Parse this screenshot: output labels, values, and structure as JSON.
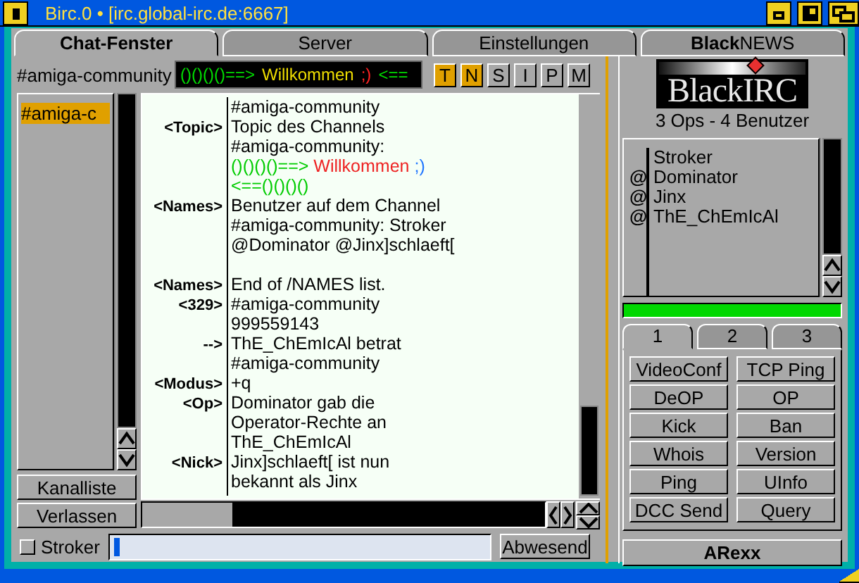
{
  "window": {
    "title": "Birc.0 • [irc.global-irc.de:6667]"
  },
  "tabs": [
    {
      "label": "Chat-Fenster",
      "selected": true
    },
    {
      "label": "Server",
      "selected": false
    },
    {
      "label": "Einstellungen",
      "selected": false
    },
    {
      "label": "**Black**NEWS",
      "selected": false
    }
  ],
  "channel": {
    "name": "#amiga-community",
    "topic": [
      {
        "text": "()()()()==>",
        "color": "#00dd00"
      },
      {
        "text": "Willkommen",
        "color": "#eedd00"
      },
      {
        "text": ";)",
        "color": "#ff2222"
      },
      {
        "text": "<==",
        "color": "#00dd00"
      }
    ]
  },
  "mode_buttons": [
    {
      "label": "T",
      "on": true
    },
    {
      "label": "N",
      "on": true
    },
    {
      "label": "S",
      "on": false
    },
    {
      "label": "I",
      "on": false
    },
    {
      "label": "P",
      "on": false
    },
    {
      "label": "M",
      "on": false
    }
  ],
  "channels": [
    {
      "name": "#amiga-c",
      "selected": true
    }
  ],
  "channel_buttons": [
    "Kanalliste",
    "Verlassen"
  ],
  "chat": [
    {
      "kind": "text",
      "text": "#amiga-community"
    },
    {
      "kind": "text",
      "prefix": "<Topic>",
      "text": "Topic des Channels"
    },
    {
      "kind": "text",
      "text": "#amiga-community:"
    },
    {
      "kind": "text",
      "segments": [
        {
          "text": "()()()()==>",
          "color": "#00cc00"
        },
        {
          "text": "  Willkommen",
          "color": "#ee2222"
        },
        {
          "text": " ;)",
          "color": "#2277ff"
        }
      ]
    },
    {
      "kind": "text",
      "segments": [
        {
          "text": "<==()()()()",
          "color": "#00cc00"
        }
      ]
    },
    {
      "kind": "text",
      "prefix": "<Names>",
      "text": "Benutzer auf dem Channel"
    },
    {
      "kind": "text",
      "text": "#amiga-community: Stroker"
    },
    {
      "kind": "text",
      "text": "@Dominator @Jinx]schlaeft["
    },
    {
      "kind": "blank"
    },
    {
      "kind": "text",
      "prefix": "<Names>",
      "text": "End of /NAMES list."
    },
    {
      "kind": "text",
      "prefix": "<329>",
      "text": "#amiga-community"
    },
    {
      "kind": "text",
      "text": "999559143"
    },
    {
      "kind": "text",
      "prefix": "-->",
      "text": "ThE_ChEmIcAl betrat"
    },
    {
      "kind": "text",
      "text": "#amiga-community"
    },
    {
      "kind": "text",
      "prefix": "<Modus>",
      "text": "+q"
    },
    {
      "kind": "text",
      "prefix": "<Op>",
      "text": "Dominator gab die"
    },
    {
      "kind": "text",
      "text": "Operator-Rechte an"
    },
    {
      "kind": "text",
      "text": "ThE_ChEmIcAl"
    },
    {
      "kind": "text",
      "prefix": "<Nick>",
      "text": "Jinx]schlaeft[ ist nun"
    },
    {
      "kind": "text",
      "text": "bekannt als Jinx"
    }
  ],
  "input": {
    "nick": "Stroker",
    "nick_checked": false,
    "away_button": "Abwesend"
  },
  "logo": "BlackIRC",
  "user_summary": "3 Ops - 4 Benutzer",
  "users": [
    {
      "name": "Stroker"
    },
    {
      "mode": "@",
      "name": "Dominator"
    },
    {
      "mode": "@",
      "name": "Jinx"
    },
    {
      "mode": "@",
      "name": "ThE_ChEmIcAl"
    }
  ],
  "lag": {
    "level": 1
  },
  "action_tabs": [
    {
      "label": "1",
      "selected": true
    },
    {
      "label": "2",
      "selected": false
    },
    {
      "label": "3",
      "selected": false
    }
  ],
  "actions": [
    "VideoConf",
    "TCP Ping",
    "DeOP",
    "OP",
    "Kick",
    "Ban",
    "Whois",
    "Version",
    "Ping",
    "UInfo",
    "DCC Send",
    "Query"
  ],
  "arexx_button": "ARexx"
}
